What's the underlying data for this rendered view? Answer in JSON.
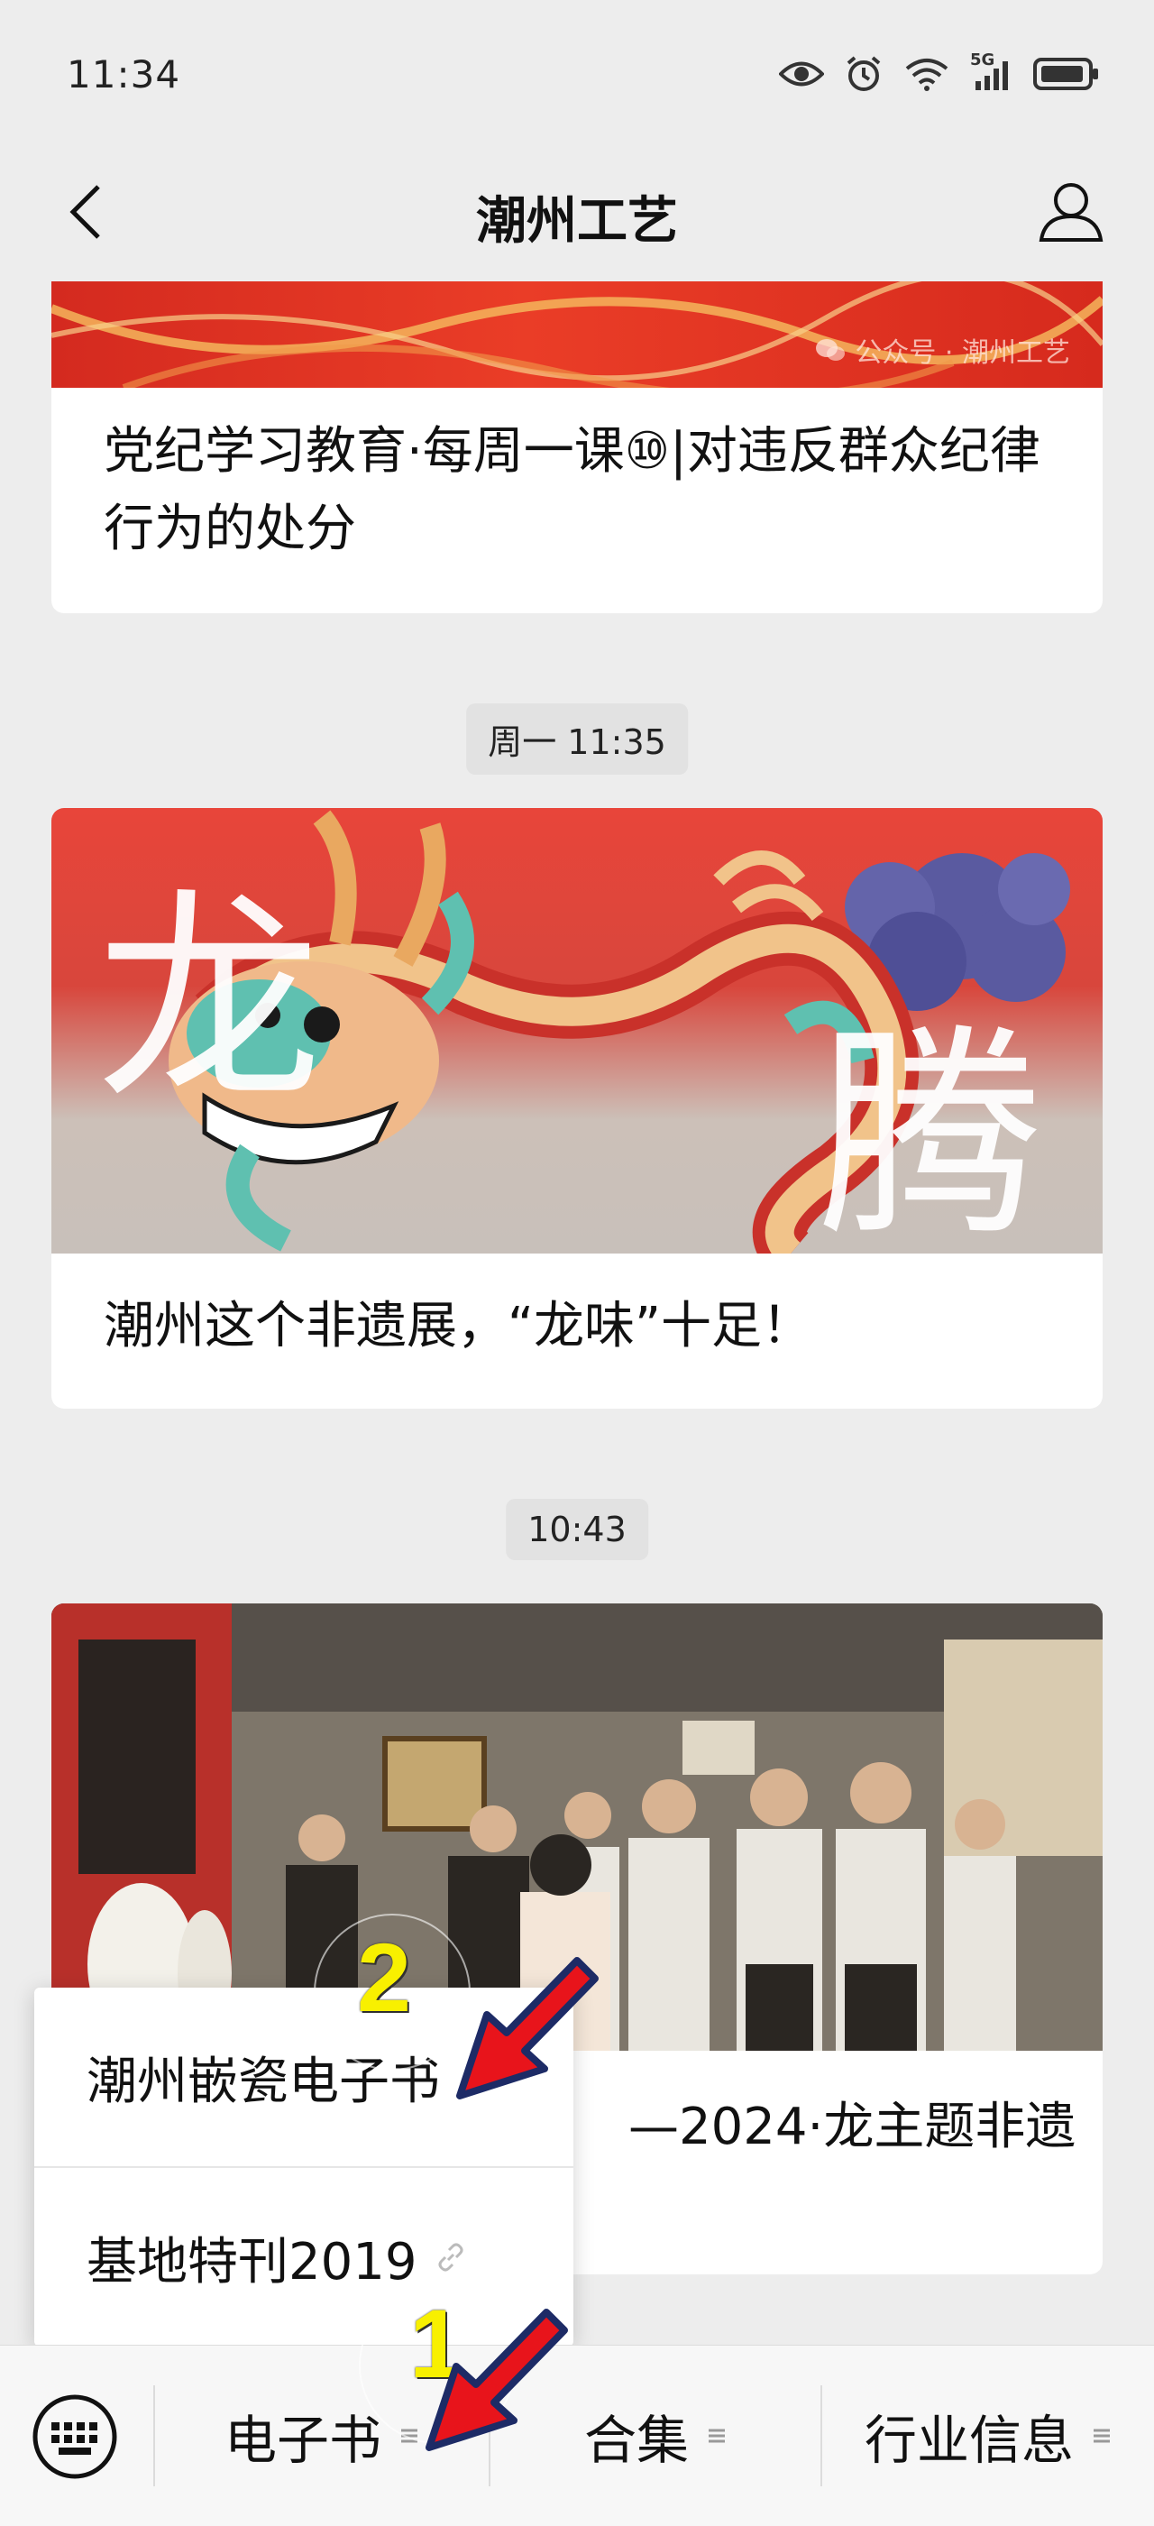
{
  "status_bar": {
    "time": "11:34",
    "icons": [
      "eye-icon",
      "alarm-icon",
      "wifi-icon",
      "signal-5g-icon",
      "battery-icon"
    ],
    "network_label": "5G"
  },
  "nav": {
    "title": "潮州工艺",
    "back_icon": "chevron-left-icon",
    "profile_icon": "person-icon"
  },
  "messages": [
    {
      "time": "",
      "title": "党纪学习教育·每周一课⑩|对违反群众纪律行为的处分",
      "watermark": "公众号 · 潮州工艺"
    },
    {
      "time": "周一 11:35",
      "title": "潮州这个非遗展，“龙味”十足！",
      "image_text_1": "龙",
      "image_text_2": "腾"
    },
    {
      "time": "10:43",
      "title_tail": "—2024·龙主题非遗"
    }
  ],
  "popup_menu": {
    "items": [
      {
        "label": "潮州嵌瓷电子书",
        "icon": "link-icon"
      },
      {
        "label": "基地特刊2019",
        "icon": "link-icon"
      }
    ]
  },
  "bottom_menu": {
    "keyboard_icon": "keyboard-icon",
    "tabs": [
      {
        "label": "电子书",
        "icon": "menu-lines-icon"
      },
      {
        "label": "合集",
        "icon": "menu-lines-icon"
      },
      {
        "label": "行业信息",
        "icon": "menu-lines-icon"
      }
    ]
  },
  "annotations": {
    "step_1": "1",
    "step_2": "2",
    "arrow_color": "#e8141b",
    "number_color": "#f8f000"
  }
}
